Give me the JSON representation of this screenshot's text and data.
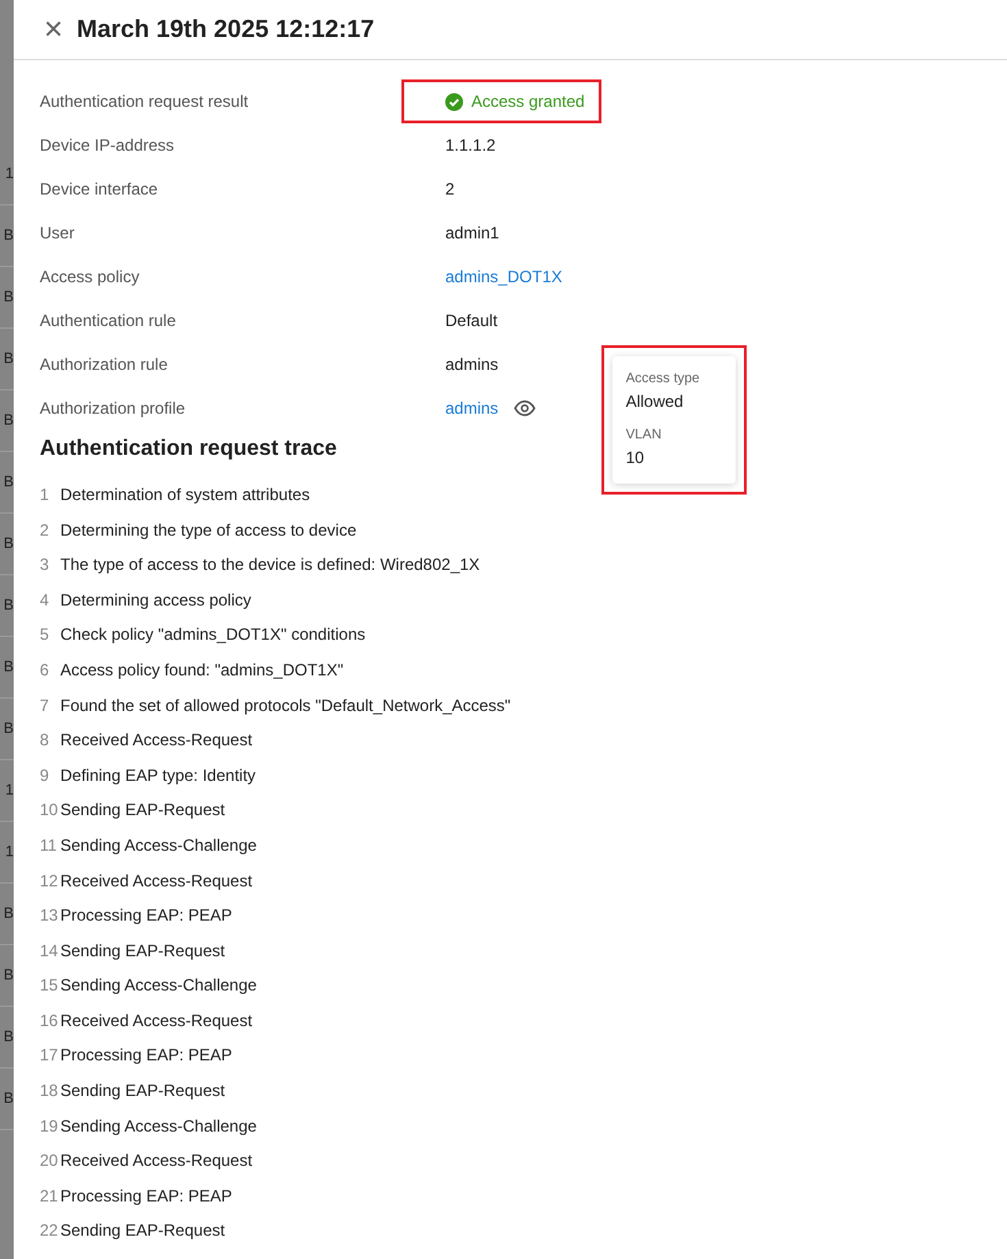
{
  "background_fragments": [
    "1",
    "B",
    "B",
    "B",
    "B",
    "B",
    "B",
    "B",
    "B",
    "B",
    "1",
    "1",
    "B",
    "B",
    "B",
    "B"
  ],
  "header": {
    "close": "×",
    "title": "March 19th 2025 12:12:17"
  },
  "details": [
    {
      "label": "Authentication request result",
      "value": "Access granted",
      "kind": "status",
      "highlighted": true
    },
    {
      "label": "Device IP-address",
      "value": "1.1.1.2",
      "kind": "text",
      "highlighted": false
    },
    {
      "label": "Device interface",
      "value": "2",
      "kind": "text",
      "highlighted": false
    },
    {
      "label": "User",
      "value": "admin1",
      "kind": "text",
      "highlighted": false
    },
    {
      "label": "Access policy",
      "value": "admins_DOT1X",
      "kind": "link",
      "highlighted": false
    },
    {
      "label": "Authentication rule",
      "value": "Default",
      "kind": "text",
      "highlighted": false
    },
    {
      "label": "Authorization rule",
      "value": "admins",
      "kind": "text",
      "highlighted": false
    },
    {
      "label": "Authorization profile",
      "value": "admins",
      "kind": "link-preview",
      "highlighted": false
    }
  ],
  "popover": {
    "highlighted": true,
    "fields": [
      {
        "label": "Access type",
        "value": "Allowed"
      },
      {
        "label": "VLAN",
        "value": "10"
      }
    ]
  },
  "trace": {
    "title": "Authentication request trace",
    "steps": [
      {
        "number": "1",
        "text": "Determination of system attributes"
      },
      {
        "number": "2",
        "text": "Determining the type of access to device"
      },
      {
        "number": "3",
        "text": "The type of access to the device is defined: Wired802_1X"
      },
      {
        "number": "4",
        "text": "Determining access policy"
      },
      {
        "number": "5",
        "text": "Check policy \"admins_DOT1X\" conditions"
      },
      {
        "number": "6",
        "text": "Access policy found: \"admins_DOT1X\""
      },
      {
        "number": "7",
        "text": "Found the set of allowed protocols \"Default_Network_Access\""
      },
      {
        "number": "8",
        "text": "Received Access-Request"
      },
      {
        "number": "9",
        "text": "Defining EAP type: Identity"
      },
      {
        "number": "10",
        "text": "Sending EAP-Request"
      },
      {
        "number": "11",
        "text": "Sending Access-Challenge"
      },
      {
        "number": "12",
        "text": "Received Access-Request"
      },
      {
        "number": "13",
        "text": "Processing EAP: PEAP"
      },
      {
        "number": "14",
        "text": "Sending EAP-Request"
      },
      {
        "number": "15",
        "text": "Sending Access-Challenge"
      },
      {
        "number": "16",
        "text": "Received Access-Request"
      },
      {
        "number": "17",
        "text": "Processing EAP: PEAP"
      },
      {
        "number": "18",
        "text": "Sending EAP-Request"
      },
      {
        "number": "19",
        "text": "Sending Access-Challenge"
      },
      {
        "number": "20",
        "text": "Received Access-Request"
      },
      {
        "number": "21",
        "text": "Processing EAP: PEAP"
      },
      {
        "number": "22",
        "text": "Sending EAP-Request"
      }
    ]
  }
}
